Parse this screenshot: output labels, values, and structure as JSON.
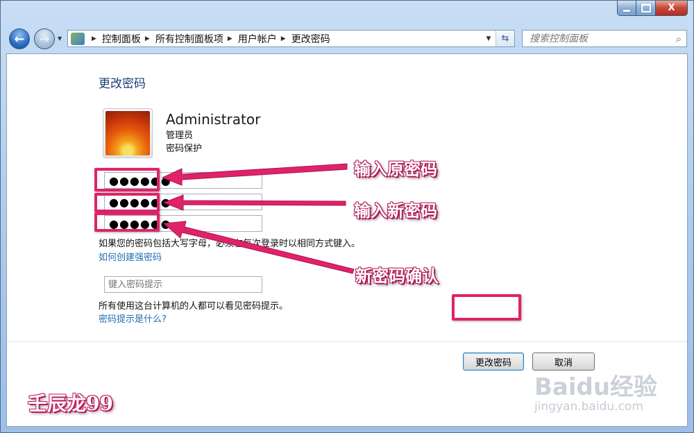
{
  "window": {
    "minimize_icon": "minimize-icon",
    "maximize_icon": "maximize-icon",
    "close_label": "X"
  },
  "nav": {
    "back_glyph": "←",
    "forward_glyph": "→",
    "breadcrumbs": [
      "控制面板",
      "所有控制面板项",
      "用户帐户",
      "更改密码"
    ],
    "search_placeholder": "搜索控制面板"
  },
  "page": {
    "title": "更改密码",
    "user": {
      "name": "Administrator",
      "role": "管理员",
      "protection": "密码保护"
    },
    "fields": {
      "current_password": "●●●●●●",
      "new_password": "●●●●●●",
      "confirm_password": "●●●●●●",
      "hint_placeholder": "键入密码提示"
    },
    "notes": {
      "case_note": "如果您的密码包括大写字母，必须在每次登录时以相同方式键入。",
      "strong_password_link": "如何创建强密码",
      "hint_note": "所有使用这台计算机的人都可以看见密码提示。",
      "hint_link": "密码提示是什么?"
    },
    "buttons": {
      "change": "更改密码",
      "cancel": "取消"
    }
  },
  "annotations": {
    "callout_current": "输入原密码",
    "callout_new": "输入新密码",
    "callout_confirm": "新密码确认",
    "author": "壬辰龙99",
    "accent_color": "#e0226a"
  },
  "watermark": {
    "logo": "Baidu经验",
    "url": "jingyan.baidu.com"
  }
}
